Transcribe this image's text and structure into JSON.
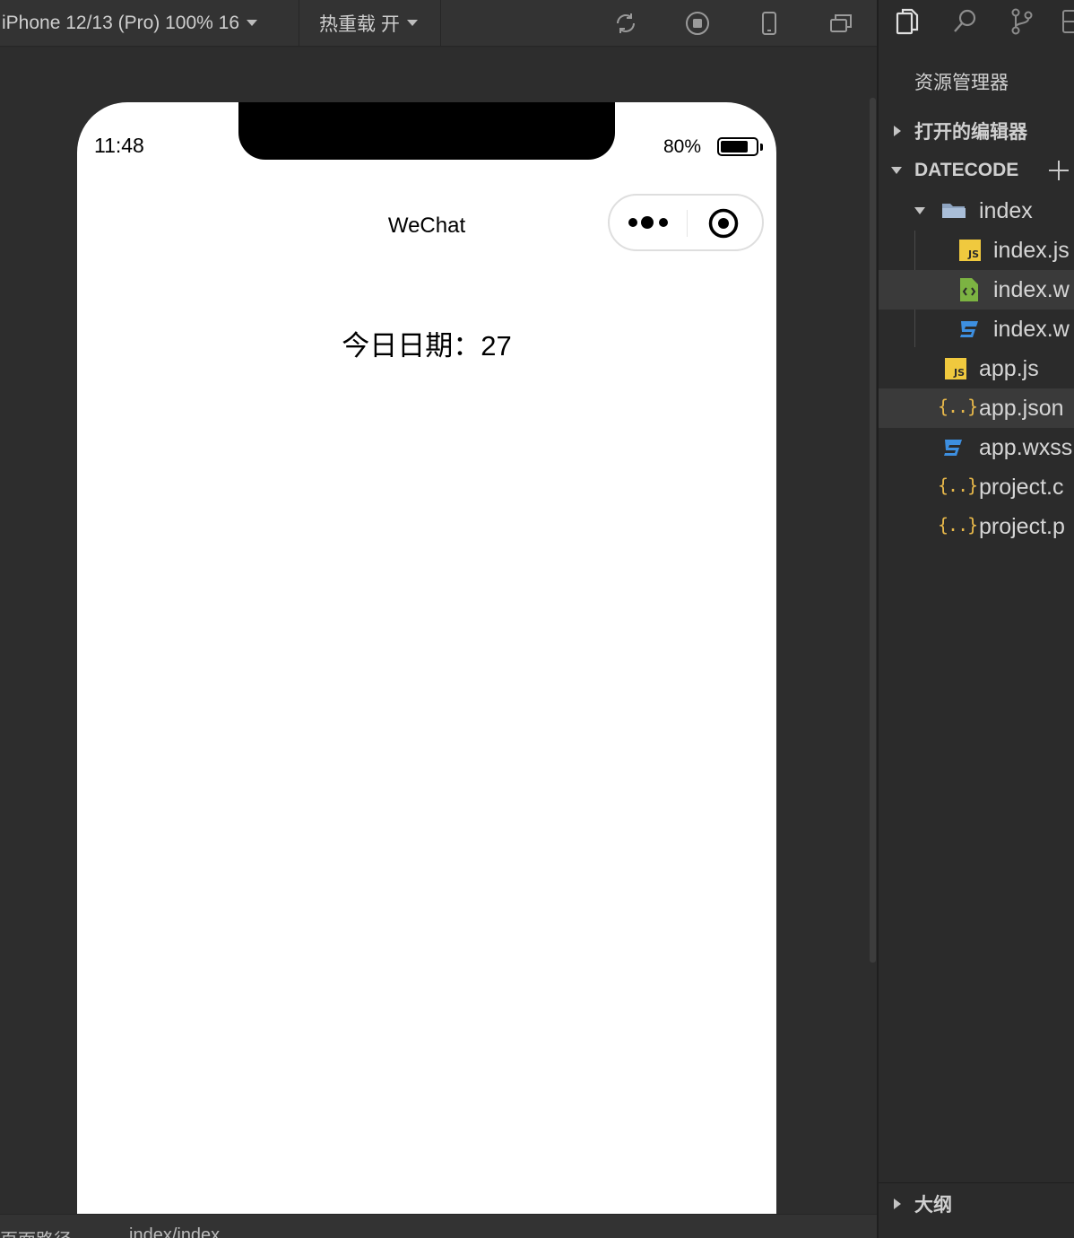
{
  "toolbar": {
    "device_select": "iPhone 12/13 (Pro) 100% 16",
    "hot_reload_select": "热重载 开",
    "icons": [
      "compile-icon",
      "stop-icon",
      "device-icon",
      "window-icon"
    ]
  },
  "simulator": {
    "status_time": "11:48",
    "battery_text": "80%",
    "battery_level": 0.8,
    "nav_title": "WeChat",
    "content_text": "今日日期：27"
  },
  "bottom_bar": {
    "page_path_label": "页面路径",
    "page_path_value": "index/index"
  },
  "explorer": {
    "title": "资源管理器",
    "open_editors": "打开的编辑器",
    "project_name": "DATECODE",
    "files": [
      {
        "name": "index",
        "type": "folder"
      },
      {
        "name": "index.js",
        "type": "js"
      },
      {
        "name": "index.w",
        "type": "wxml"
      },
      {
        "name": "index.w",
        "type": "wxss"
      },
      {
        "name": "app.js",
        "type": "js"
      },
      {
        "name": "app.json",
        "type": "json"
      },
      {
        "name": "app.wxss",
        "type": "wxss"
      },
      {
        "name": "project.c",
        "type": "json"
      },
      {
        "name": "project.p",
        "type": "json"
      }
    ],
    "outline": "大纲"
  },
  "colors": {
    "ide_background": "#2b2b2b",
    "phone_background": "#ffffff",
    "js_badge": "#f0c93e",
    "json_icon": "#e8b84a",
    "css_icon": "#3d8fe0",
    "wxml_icon": "#7cb342"
  }
}
